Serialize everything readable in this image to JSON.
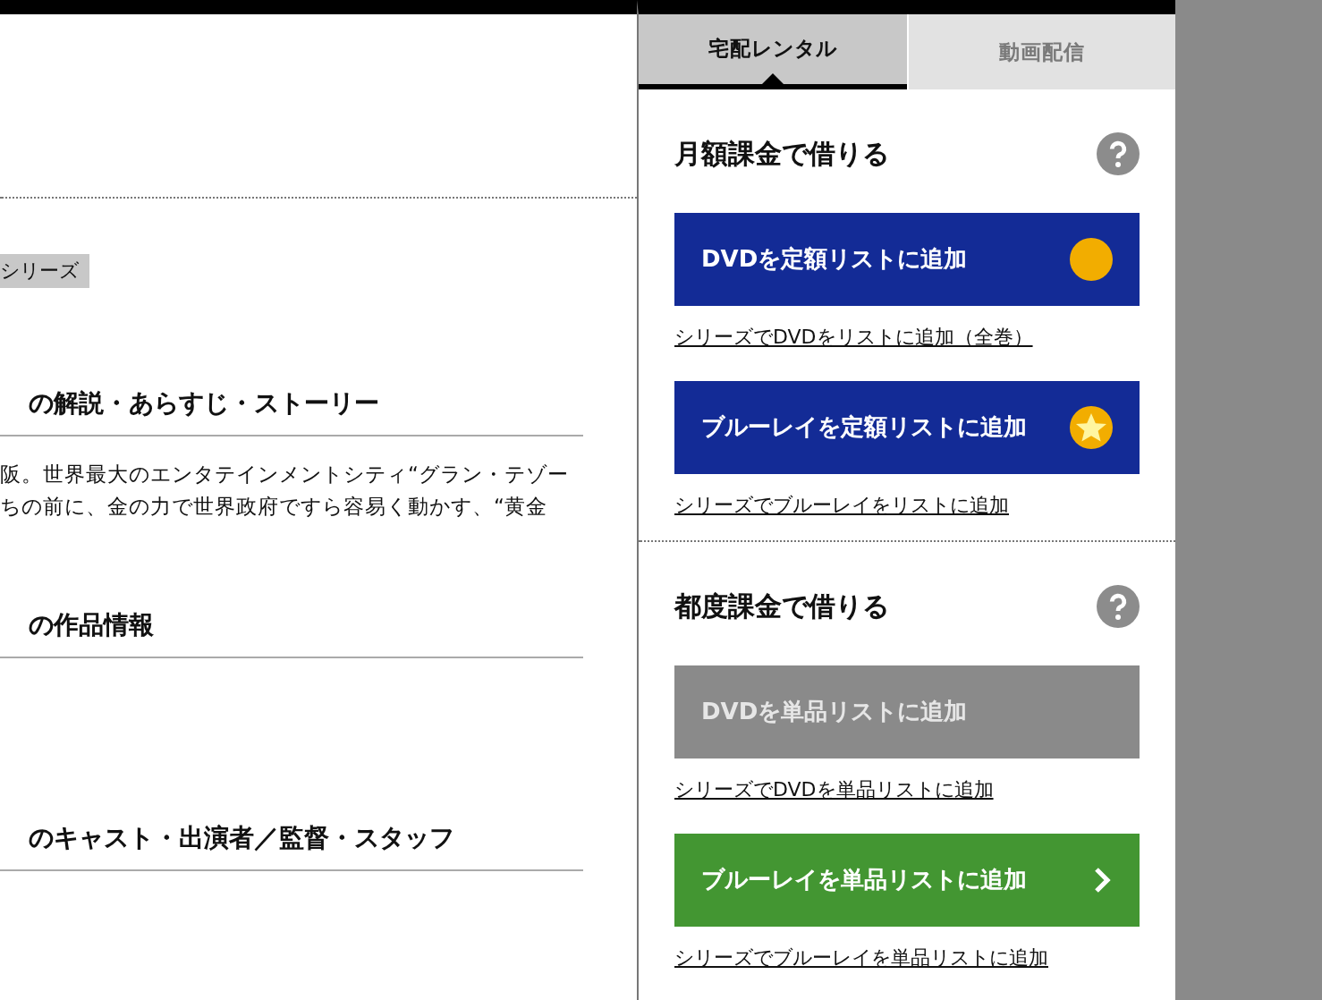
{
  "main": {
    "tag": "シリーズ",
    "sections": [
      {
        "heading": "の解説・あらすじ・ストーリー",
        "paragraph": [
          "阪。世界最大のエンタテインメントシティ“グラン・テゾー",
          "ちの前に、金の力で世界政府ですら容易く動かす、“黄金"
        ]
      },
      {
        "heading": "の作品情報"
      },
      {
        "heading": "のキャスト・出演者／監督・スタッフ"
      }
    ]
  },
  "panel": {
    "tabs": [
      {
        "label": "宅配レンタル",
        "selected": true
      },
      {
        "label": "動画配信",
        "selected": false
      }
    ],
    "groups": [
      {
        "title": "月額課金で借りる",
        "items": [
          {
            "button": "DVDを定額リストに追加",
            "kind": "coin",
            "color": "#132b96",
            "disabled": false,
            "link": "シリーズでDVDをリストに追加（全巻）"
          },
          {
            "button": "ブルーレイを定額リストに追加",
            "kind": "star",
            "color": "#132b96",
            "disabled": false,
            "link": "シリーズでブルーレイをリストに追加"
          }
        ]
      },
      {
        "title": "都度課金で借りる",
        "items": [
          {
            "button": "DVDを単品リストに追加",
            "kind": "plain",
            "color": "#8a8a8a",
            "disabled": true,
            "link": "シリーズでDVDを単品リストに追加"
          },
          {
            "button": "ブルーレイを単品リストに追加",
            "kind": "arrow",
            "color": "#439632",
            "disabled": false,
            "link": "シリーズでブルーレイを単品リストに追加"
          }
        ]
      }
    ]
  }
}
